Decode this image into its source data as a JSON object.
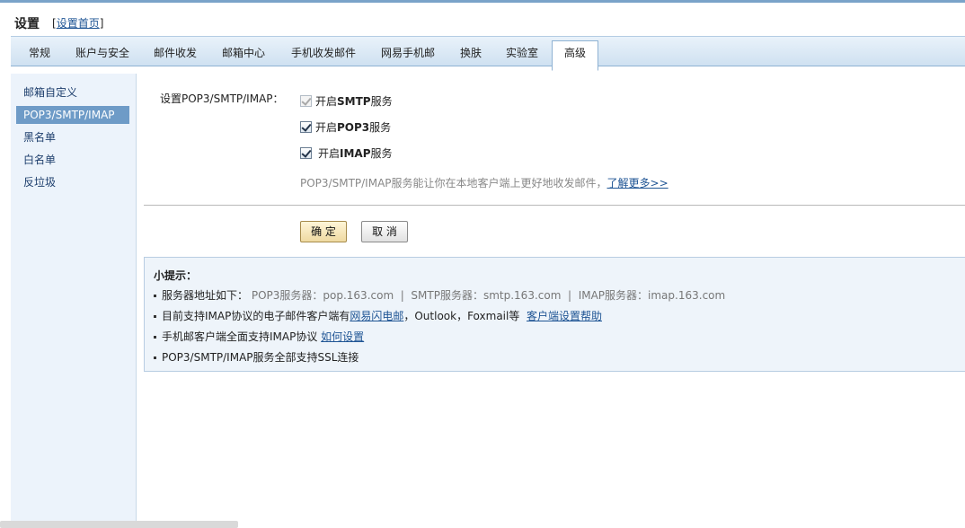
{
  "header": {
    "title": "设置",
    "link_prefix": "[",
    "link_label": "设置首页",
    "link_suffix": "]"
  },
  "tabs": [
    {
      "label": "常规"
    },
    {
      "label": "账户与安全"
    },
    {
      "label": "邮件收发"
    },
    {
      "label": "邮箱中心"
    },
    {
      "label": "手机收发邮件"
    },
    {
      "label": "网易手机邮"
    },
    {
      "label": "换肤"
    },
    {
      "label": "实验室"
    },
    {
      "label": "高级",
      "active": true
    }
  ],
  "sidebar": {
    "items": [
      {
        "label": "邮箱自定义"
      },
      {
        "label": "POP3/SMTP/IMAP",
        "active": true
      },
      {
        "label": "黑名单"
      },
      {
        "label": "白名单"
      },
      {
        "label": "反垃圾"
      }
    ]
  },
  "settings": {
    "label": "设置POP3/SMTP/IMAP：",
    "options": [
      {
        "prefix": "开启",
        "name": "SMTP",
        "suffix": "服务",
        "checked": true,
        "disabled": true
      },
      {
        "prefix": "开启",
        "name": "POP3",
        "suffix": "服务",
        "checked": true,
        "disabled": false
      },
      {
        "prefix": "开启",
        "name": "IMAP",
        "suffix": "服务",
        "checked": true,
        "disabled": false
      }
    ],
    "note": "POP3/SMTP/IMAP服务能让你在本地客户端上更好地收发邮件，",
    "note_link": "了解更多>>"
  },
  "buttons": {
    "ok": "确 定",
    "cancel": "取 消"
  },
  "tips": {
    "title": "小提示：",
    "server_prefix": "服务器地址如下：",
    "server_details": "POP3服务器：pop.163.com  |  SMTP服务器：smtp.163.com  |  IMAP服务器：imap.163.com",
    "clients_text": "目前支持IMAP协议的电子邮件客户端有",
    "clients_link": "网易闪电邮",
    "clients_rest": "，Outlook，Foxmail等",
    "clients_help": "客户端设置帮助",
    "mobile_text": "手机邮客户端全面支持IMAP协议",
    "mobile_link": "如何设置",
    "ssl_text": "POP3/SMTP/IMAP服务全部支持SSL连接"
  }
}
